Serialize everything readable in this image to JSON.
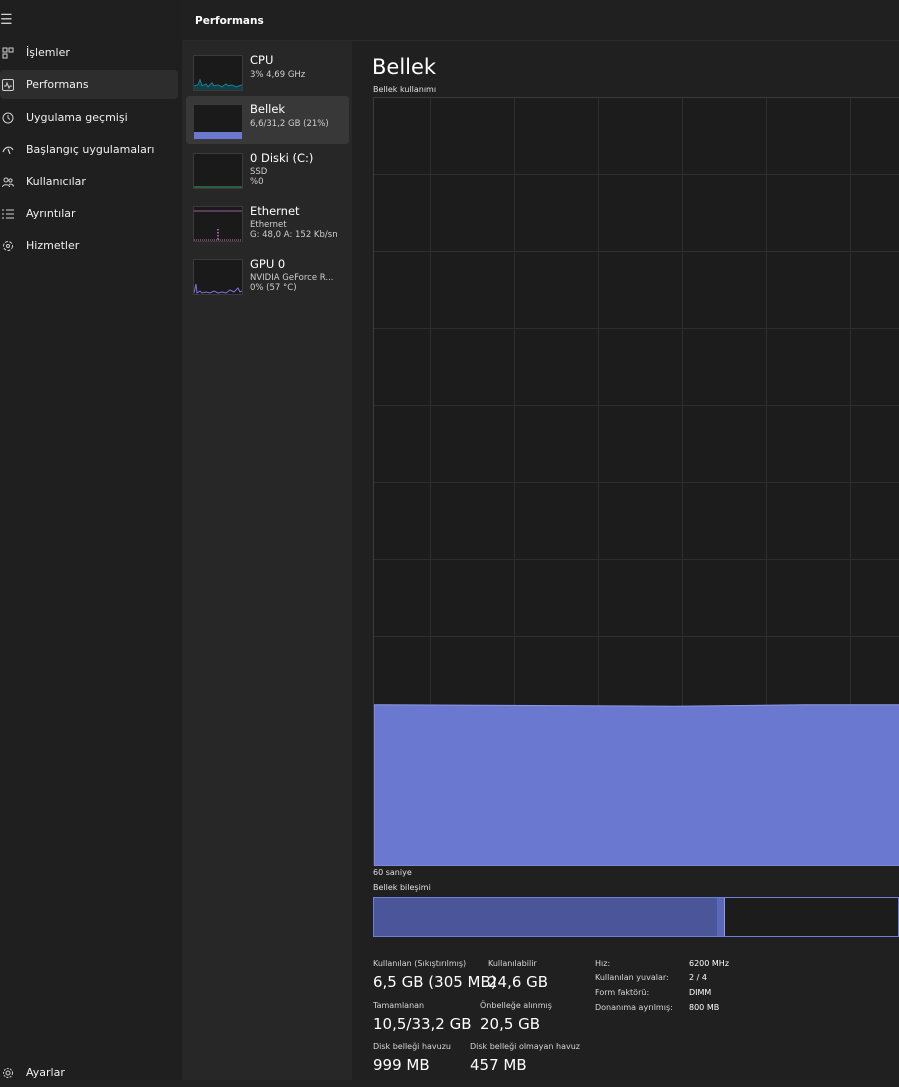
{
  "nav": {
    "menu_icon": "hamburger-icon",
    "items": [
      {
        "label": "İşlemler",
        "icon": "processes-icon"
      },
      {
        "label": "Performans",
        "icon": "performance-icon",
        "active": true
      },
      {
        "label": "Uygulama geçmişi",
        "icon": "history-icon"
      },
      {
        "label": "Başlangıç uygulamaları",
        "icon": "startup-icon"
      },
      {
        "label": "Kullanıcılar",
        "icon": "users-icon"
      },
      {
        "label": "Ayrıntılar",
        "icon": "details-icon"
      },
      {
        "label": "Hizmetler",
        "icon": "services-icon"
      }
    ],
    "settings": {
      "label": "Ayarlar",
      "icon": "settings-icon"
    }
  },
  "header": {
    "title": "Performans"
  },
  "devices": [
    {
      "name": "CPU",
      "line1": "3% 4,69 GHz",
      "line2": "",
      "line3": ""
    },
    {
      "name": "Bellek",
      "line1": "6,6/31,2 GB (21%)",
      "line2": "",
      "line3": "",
      "active": true
    },
    {
      "name": "0 Diski (C:)",
      "line1": "SSD",
      "line2": "%0",
      "line3": ""
    },
    {
      "name": "Ethernet",
      "line1": "Ethernet",
      "line2": "G: 48,0 A: 152 Kb/sn",
      "line3": ""
    },
    {
      "name": "GPU 0",
      "line1": "NVIDIA GeForce R...",
      "line2": "0% (57 °C)",
      "line3": ""
    }
  ],
  "main": {
    "title": "Bellek",
    "chart_label": "Bellek kullanımı",
    "time_label": "60 saniye",
    "composition_label": "Bellek bileşimi",
    "usage_percent": 21,
    "composition": {
      "in_use_fraction": 0.655,
      "modified_fraction": 0.013
    },
    "stats": {
      "in_use_label": "Kullanılan (Sıkıştırılmış)",
      "in_use_value": "6,5 GB (305 MB)",
      "available_label": "Kullanılabilir",
      "available_value": "24,6 GB",
      "committed_label": "Tamamlanan",
      "committed_value": "10,5/33,2 GB",
      "cached_label": "Önbelleğe alınmış",
      "cached_value": "20,5 GB",
      "paged_label": "Disk belleği havuzu",
      "paged_value": "999 MB",
      "nonpaged_label": "Disk belleği olmayan havuz",
      "nonpaged_value": "457 MB"
    },
    "details": [
      {
        "label": "Hız:",
        "value": "6200 MHz"
      },
      {
        "label": "Kullanılan yuvalar:",
        "value": "2 / 4"
      },
      {
        "label": "Form faktörü:",
        "value": "DIMM"
      },
      {
        "label": "Donanıma ayrılmış:",
        "value": "800 MB"
      }
    ]
  },
  "colors": {
    "memory": "#6a78cf",
    "memory_dark": "#4a5699",
    "cpu": "#17a2b8",
    "eth": "#d16fc7",
    "gpu": "#8a6fd6"
  }
}
